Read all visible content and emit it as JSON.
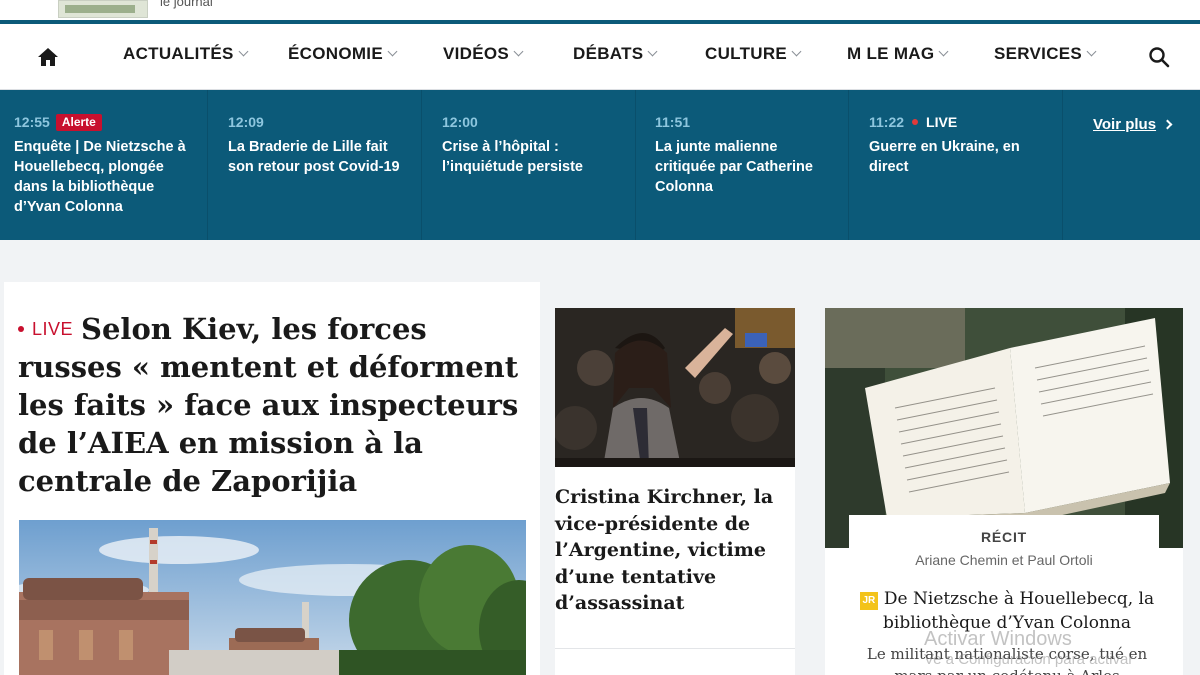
{
  "header": {
    "subtitle": "le journal"
  },
  "nav": {
    "items": [
      {
        "label": "ACTUALITÉS"
      },
      {
        "label": "ÉCONOMIE"
      },
      {
        "label": "VIDÉOS"
      },
      {
        "label": "DÉBATS"
      },
      {
        "label": "CULTURE"
      },
      {
        "label": "M LE MAG"
      },
      {
        "label": "SERVICES"
      }
    ]
  },
  "live_bar": {
    "items": [
      {
        "time": "12:55",
        "tag": "Alerte",
        "headline": "Enquête | De Nietzsche à Houellebecq, plongée dans la bibliothèque d’Yvan Colonna"
      },
      {
        "time": "12:09",
        "headline": "La Braderie de Lille fait son retour post Covid-19"
      },
      {
        "time": "12:00",
        "headline": "Crise à l’hôpital : l’inquiétude persiste"
      },
      {
        "time": "11:51",
        "headline": "La junte malienne critiquée par Catherine Colonna"
      },
      {
        "time": "11:22",
        "tag": "LIVE",
        "headline": "Guerre en Ukraine, en direct"
      }
    ],
    "more_label": "Voir plus"
  },
  "lead": {
    "live_label": "LIVE",
    "title": "Selon Kiev, les forces russes « mentent et déforment les faits » face aux inspecteurs de l’AIEA en mission à la centrale de Zaporijia"
  },
  "middle": {
    "title": "Cristina Kirchner, la vice-présidente de l’Argentine, victime d’une tentative d’assassinat"
  },
  "right": {
    "kicker": "RÉCIT",
    "authors": "Ariane Chemin et Paul Ortoli",
    "badge": "JR",
    "title": "De Nietzsche à Houellebecq, la bibliothèque d’Yvan Colonna",
    "summary": "Le militant nationaliste corse, tué en mars par un codétenu à Arles"
  },
  "watermark": {
    "line1": "Activar Windows",
    "line2": "Ve a Configuración para activar"
  },
  "colors": {
    "brand_blue": "#0c5a79",
    "alert_red": "#c8102e",
    "badge_yellow": "#f3c31a"
  }
}
